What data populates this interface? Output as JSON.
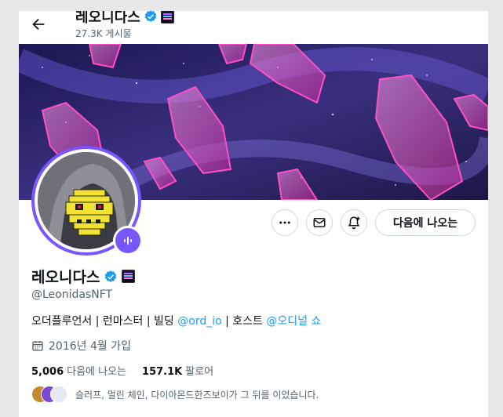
{
  "header": {
    "title": "레오니다스",
    "post_count": "27.3K 게시물"
  },
  "actions": {
    "follow_label": "다음에 나오는"
  },
  "profile": {
    "display_name": "레오니다스",
    "handle": "@LeonidasNFT",
    "bio_text_1": "오더플루언서 | 런마스터 | 빌딩 ",
    "bio_link_1": "@ord_io",
    "bio_text_2": " | 호스트 ",
    "bio_link_2": "@오디널 쇼",
    "joined": "2016년 4월 가입"
  },
  "stats": {
    "following_count": "5,006",
    "following_label": "다음에 나오는",
    "followers_count": "157.1K",
    "followers_label": "팔로어"
  },
  "followed_by": {
    "text": "슬러프, 멀린 체인, 다이아몬드한즈보이가 그 뒤를 이었습니다."
  },
  "colors": {
    "accent": "#1d9bf0",
    "verified": "#1d9bf0",
    "avatar_ring": "#7856ff",
    "muted_text": "#536471"
  },
  "icons": [
    "back-arrow-icon",
    "verified-icon",
    "affiliate-badge-icon",
    "more-icon",
    "message-icon",
    "notification-add-icon",
    "calendar-icon",
    "live-audio-icon"
  ]
}
